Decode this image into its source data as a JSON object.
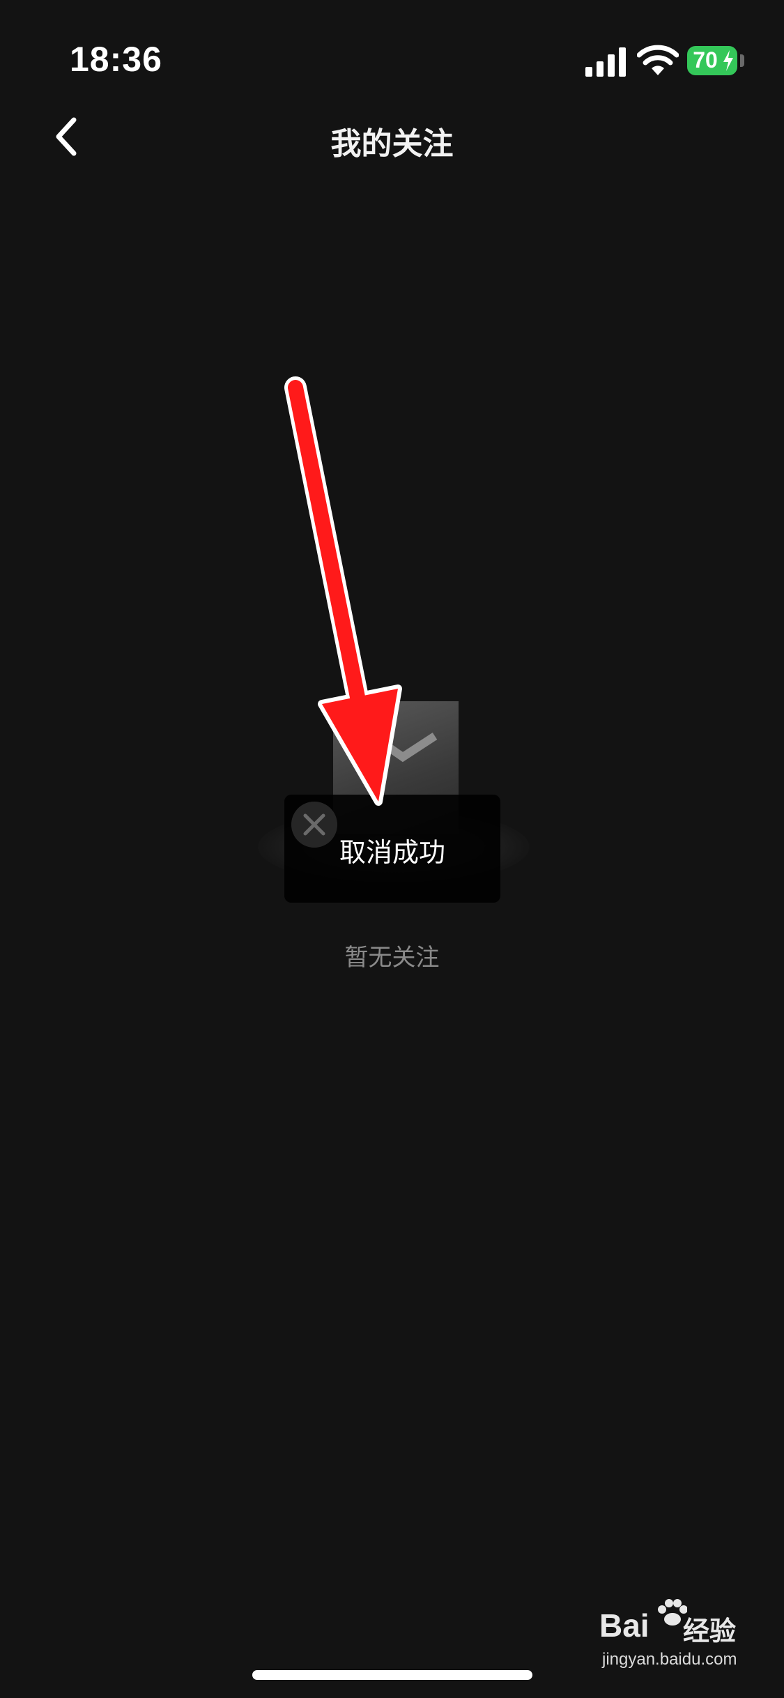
{
  "status_bar": {
    "time": "18:36",
    "battery_level": "70",
    "icons": [
      "cellular-signal-icon",
      "wifi-icon",
      "battery-charging-icon"
    ]
  },
  "nav": {
    "back_icon": "chevron-left-icon",
    "title": "我的关注"
  },
  "toast": {
    "message": "取消成功",
    "icon": "close-icon"
  },
  "empty_state": {
    "text": "暂无关注"
  },
  "watermark": {
    "brand": "Bai",
    "brand_cn": "经验",
    "url": "jingyan.baidu.com"
  },
  "colors": {
    "background": "#131313",
    "battery": "#34c759",
    "arrow": "#ff1a1a"
  }
}
